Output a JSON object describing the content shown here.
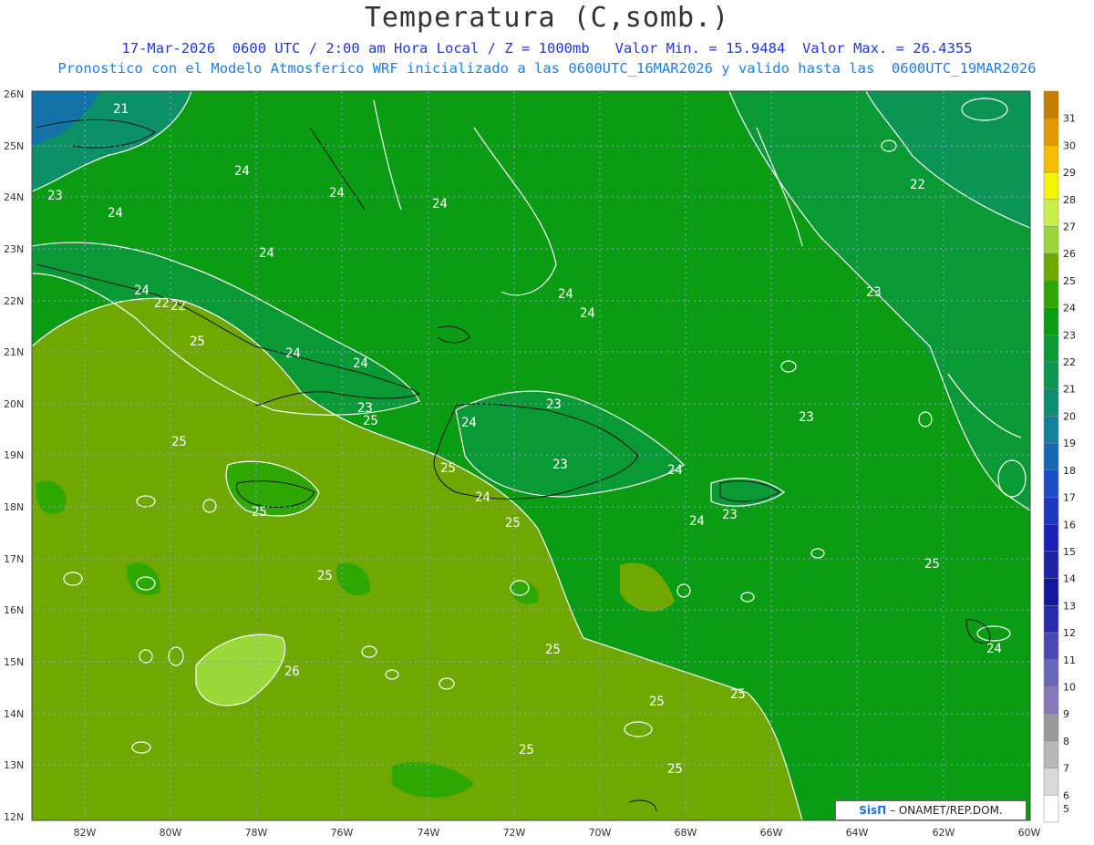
{
  "header": {
    "title": "Temperatura (C,somb.)",
    "subtitle_line1": "17-Mar-2026  0600 UTC / 2:00 am Hora Local / Z = 1000mb   Valor Min. = 15.9484  Valor Max. = 26.4355",
    "subtitle_line2": "Pronostico con el Modelo Atmosferico WRF inicializado a las 0600UTC_16MAR2026 y valido hasta las  0600UTC_19MAR2026"
  },
  "map": {
    "lat_labels": [
      "26N",
      "25N",
      "24N",
      "23N",
      "22N",
      "21N",
      "20N",
      "19N",
      "18N",
      "17N",
      "16N",
      "15N",
      "14N",
      "13N",
      "12N"
    ],
    "lon_labels": [
      "82W",
      "80W",
      "78W",
      "76W",
      "74W",
      "72W",
      "70W",
      "68W",
      "66W",
      "64W",
      "62W",
      "60W"
    ],
    "contour_labels": [
      {
        "text": "21"
      },
      {
        "text": "23"
      },
      {
        "text": "24"
      },
      {
        "text": "24"
      },
      {
        "text": "24"
      },
      {
        "text": "24"
      },
      {
        "text": "22"
      },
      {
        "text": "24"
      },
      {
        "text": "24"
      },
      {
        "text": "25"
      },
      {
        "text": "24"
      },
      {
        "text": "22"
      },
      {
        "text": "24"
      },
      {
        "text": "23"
      },
      {
        "text": "23"
      },
      {
        "text": "25"
      },
      {
        "text": "25"
      },
      {
        "text": "24"
      },
      {
        "text": "25"
      },
      {
        "text": "23"
      },
      {
        "text": "24"
      },
      {
        "text": "24"
      },
      {
        "text": "23"
      },
      {
        "text": "24"
      },
      {
        "text": "24"
      },
      {
        "text": "23"
      },
      {
        "text": "25"
      },
      {
        "text": "25"
      },
      {
        "text": "25"
      },
      {
        "text": "24"
      },
      {
        "text": "25"
      },
      {
        "text": "26"
      },
      {
        "text": "25"
      },
      {
        "text": "25"
      },
      {
        "text": "25"
      },
      {
        "text": "24"
      },
      {
        "text": "25"
      },
      {
        "text": "25"
      },
      {
        "text": "22"
      },
      {
        "text": "23"
      }
    ]
  },
  "colorbar": {
    "levels": [
      "31",
      "30",
      "29",
      "28",
      "27",
      "26",
      "25",
      "24",
      "23",
      "22",
      "21",
      "20",
      "19",
      "18",
      "17",
      "16",
      "15",
      "14",
      "13",
      "12",
      "11",
      "10",
      "9",
      "8",
      "7",
      "6",
      "5"
    ],
    "colors": [
      "#c47f00",
      "#e09a00",
      "#f5be00",
      "#f5f500",
      "#c8f048",
      "#98d838",
      "#6ea800",
      "#2ea800",
      "#0a9c12",
      "#0a9a35",
      "#0c9650",
      "#0a8e6e",
      "#12829a",
      "#1568b8",
      "#1a4cc8",
      "#1a38c0",
      "#1a20b8",
      "#2020a8",
      "#1414a0",
      "#2a2ab0",
      "#4848b8",
      "#6868b8",
      "#8878b8",
      "#9a9a9a",
      "#b8b8b8",
      "#d8d8d8",
      "#ffffff"
    ]
  },
  "credit": {
    "brand": "SisΠ",
    "org": "– ONAMET/REP.DOM."
  }
}
